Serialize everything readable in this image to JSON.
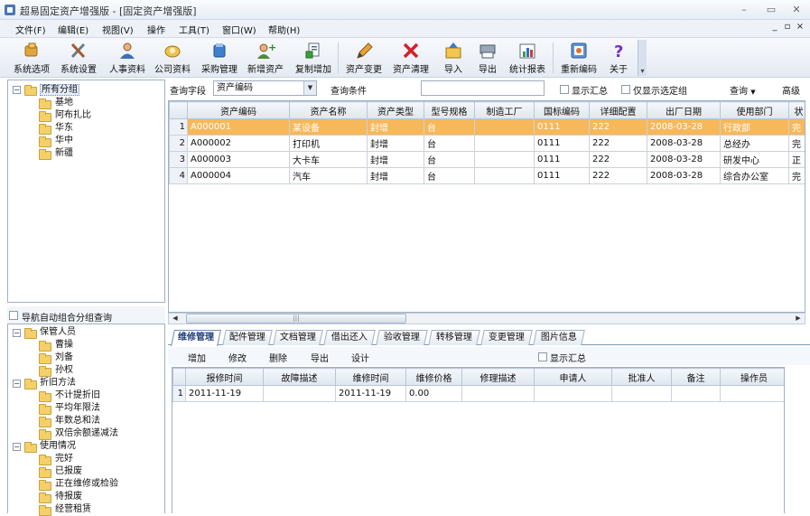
{
  "window": {
    "title": "超易固定资产增强版 - [固定资产增强版]"
  },
  "menu": {
    "items": [
      "文件(F)",
      "编辑(E)",
      "视图(V)",
      "操作",
      "工具(T)",
      "窗口(W)",
      "帮助(H)"
    ]
  },
  "toolbar": {
    "buttons": [
      {
        "label": "系统选项",
        "icon": "system-options-icon"
      },
      {
        "label": "系统设置",
        "icon": "tools-icon"
      },
      {
        "label": "人事资料",
        "icon": "person-icon"
      },
      {
        "label": "公司资料",
        "icon": "company-icon"
      },
      {
        "label": "采购管理",
        "icon": "purchase-icon"
      },
      {
        "label": "新增资产",
        "icon": "add-asset-icon"
      },
      {
        "label": "复制增加",
        "icon": "copy-add-icon"
      },
      {
        "label": "资产变更",
        "icon": "pencil-icon"
      },
      {
        "label": "资产清理",
        "icon": "delete-x-icon"
      },
      {
        "label": "导入",
        "icon": "import-icon"
      },
      {
        "label": "导出",
        "icon": "export-icon"
      },
      {
        "label": "统计报表",
        "icon": "chart-icon"
      },
      {
        "label": "重新编码",
        "icon": "recode-icon"
      },
      {
        "label": "关于",
        "icon": "help-question-icon"
      }
    ]
  },
  "group_tree": {
    "root": "所有分组",
    "children": [
      "基地",
      "阿布扎比",
      "华东",
      "华中",
      "新疆"
    ]
  },
  "nav_panel": {
    "checkbox_label": "导航自动组合分组查询",
    "sections": [
      {
        "label": "保管人员",
        "children": [
          "曹操",
          "刘备",
          "孙权"
        ]
      },
      {
        "label": "折旧方法",
        "children": [
          "不计提折旧",
          "平均年限法",
          "年数总和法",
          "双倍余额递减法"
        ]
      },
      {
        "label": "使用情况",
        "children": [
          "完好",
          "已报废",
          "正在维修或检验",
          "待报废",
          "经营租赁"
        ]
      }
    ]
  },
  "query": {
    "field_label": "查询字段",
    "field_value": "资产编码",
    "condition_label": "查询条件",
    "condition_value": "",
    "show_summary": "显示汇总",
    "only_selected_group": "仅显示选定组",
    "query_button": "查询",
    "advanced_button": "高级"
  },
  "assets_table": {
    "columns": [
      "",
      "资产编码",
      "资产名称",
      "资产类型",
      "型号规格",
      "制造工厂",
      "国标编码",
      "详细配置",
      "出厂日期",
      "使用部门",
      "状"
    ],
    "rows": [
      [
        "1",
        "A000001",
        "某设备",
        "封增",
        "台",
        "",
        "0111",
        "222",
        "2008-03-28",
        "行政部",
        "完"
      ],
      [
        "2",
        "A000002",
        "打印机",
        "封增",
        "台",
        "",
        "0111",
        "222",
        "2008-03-28",
        "总经办",
        "完"
      ],
      [
        "3",
        "A000003",
        "大卡车",
        "封增",
        "台",
        "",
        "0111",
        "222",
        "2008-03-28",
        "研发中心",
        "正"
      ],
      [
        "4",
        "A000004",
        "汽车",
        "封增",
        "台",
        "",
        "0111",
        "222",
        "2008-03-28",
        "综合办公室",
        "完"
      ]
    ],
    "selected_row": 0
  },
  "detail_tabs": {
    "tabs": [
      "维修管理",
      "配件管理",
      "文档管理",
      "借出还入",
      "验收管理",
      "转移管理",
      "变更管理",
      "图片信息"
    ],
    "active": 0
  },
  "repair_toolbar": {
    "buttons": [
      "增加",
      "修改",
      "删除",
      "导出",
      "设计"
    ],
    "show_summary": "显示汇总"
  },
  "repair_table": {
    "columns": [
      "",
      "报修时间",
      "故障描述",
      "维修时间",
      "维修价格",
      "修理描述",
      "申请人",
      "批准人",
      "备注",
      "操作员"
    ],
    "rows": [
      [
        "1",
        "2011-11-19",
        "",
        "2011-11-19",
        "0.00",
        "",
        "",
        "",
        "",
        ""
      ]
    ]
  },
  "colors": {
    "selected_row": "#f7b85a",
    "tab_border": "#7f9ab8",
    "panel_border": "#9fb0c4"
  }
}
